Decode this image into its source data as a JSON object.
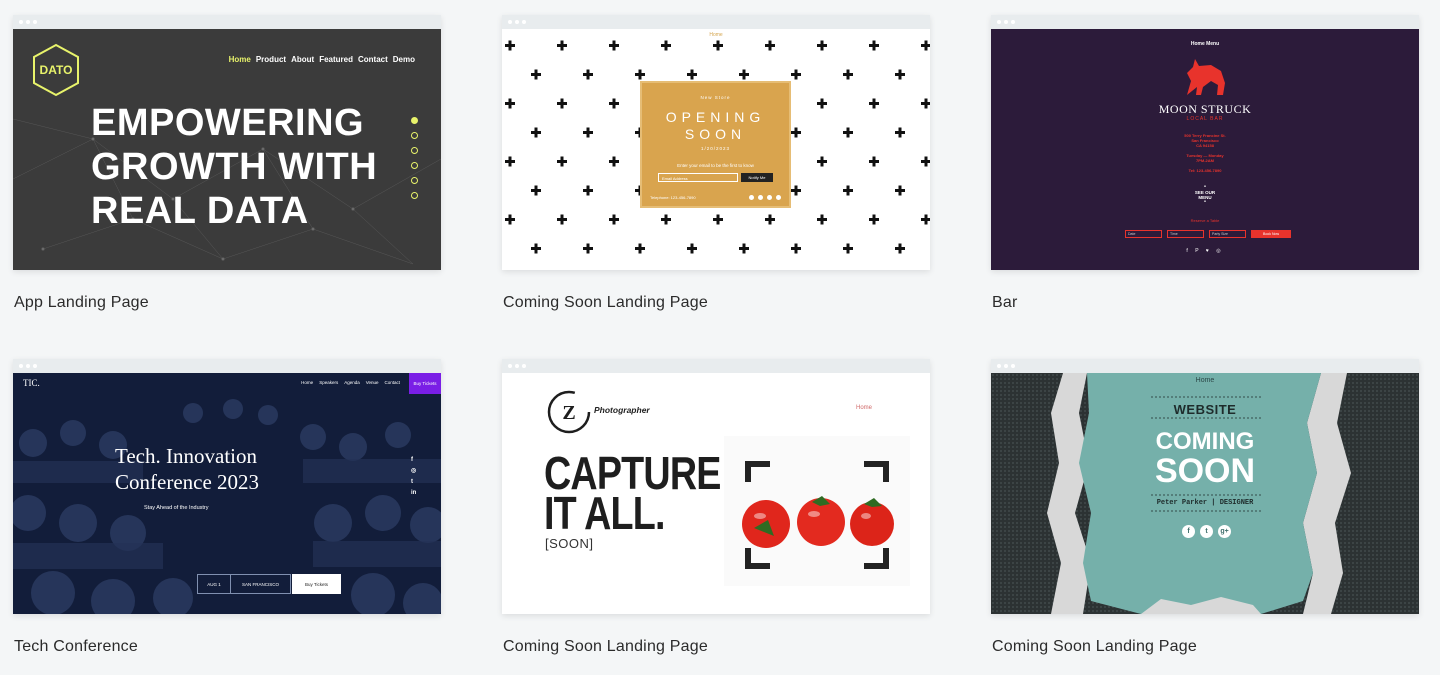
{
  "templates": [
    {
      "caption": "App Landing Page",
      "logo": "DATO",
      "nav": [
        "Home",
        "Product",
        "About",
        "Featured",
        "Contact",
        "Demo"
      ],
      "hero": [
        "EMPOWERING",
        "GROWTH WITH",
        "REAL DATA"
      ],
      "accent_color": "#e8f36b"
    },
    {
      "caption": "Coming Soon Landing Page",
      "home": "Home",
      "kicker": "New Store",
      "title_line1": "OPENING",
      "title_line2": "SOON",
      "date": "1/20/2023",
      "prompt": "Enter your email to be the first to know",
      "email_placeholder": "Email Address",
      "button": "Notify Me",
      "phone": "Telephone: 123-456-7890",
      "card_color": "#d9a44e"
    },
    {
      "caption": "Bar",
      "nav": "Home   Menu",
      "name": "MOON STRUCK",
      "subtitle": "LOCAL BAR",
      "address": [
        "500 Terry Francine St.",
        "San Francisco",
        "CA 94158"
      ],
      "hours": [
        "Tuesday — Monday",
        "7PM-2AM"
      ],
      "phone": "Tel: 123-456-7890",
      "menu": [
        "SEE OUR",
        "MENU"
      ],
      "reserve": "Reserve a Table",
      "form": [
        "Date",
        "Time",
        "Party Size",
        "Book Now"
      ],
      "socials": "f P ♥ ◎",
      "accent_color": "#e8332c"
    },
    {
      "caption": "Tech Conference",
      "logo": "TIC.",
      "nav": [
        "Home",
        "Speakers",
        "Agenda",
        "Venue",
        "Contact"
      ],
      "buy_tickets": "Buy Tickets",
      "title_line1": "Tech. Innovation",
      "title_line2": "Conference 2023",
      "tagline": "Stay Ahead of the Industry",
      "date": "AUG 1",
      "city": "SAN FRANCISCO",
      "cta": "Buy Tickets",
      "side_icons": [
        "f",
        "◎",
        "t",
        "in"
      ],
      "accent_color": "#7a1ee6"
    },
    {
      "caption": "Coming Soon Landing Page",
      "logo_letter": "Z",
      "brand": "Photographer",
      "home": "Home",
      "headline_line1": "CAPTURE",
      "headline_line2": "IT ALL.",
      "soon": "[SOON]"
    },
    {
      "caption": "Coming Soon Landing Page",
      "home": "Home",
      "kicker": "WEBSITE",
      "title_line1": "COMING",
      "title_line2": "SOON",
      "person": "Peter Parker | DESIGNER",
      "socials": [
        "f",
        "t",
        "g+"
      ],
      "panel_color": "#75b0aa"
    }
  ]
}
